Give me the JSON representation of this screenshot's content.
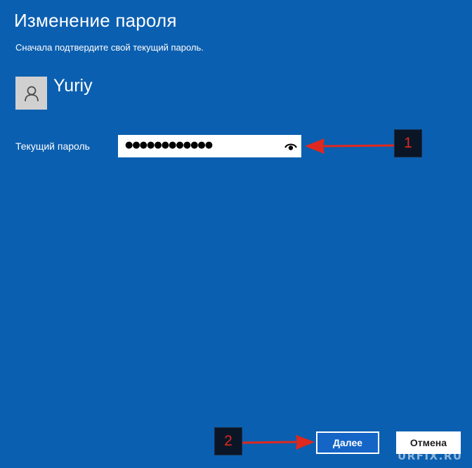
{
  "dialog": {
    "title": "Изменение пароля",
    "subtitle": "Сначала подтвердите свой текущий пароль."
  },
  "account": {
    "username": "Yuriy",
    "avatar_icon": "user-silhouette-icon"
  },
  "current_password": {
    "label": "Текущий пароль",
    "masked_value": "●●●●●●●●●●●●",
    "reveal_icon": "eye-icon"
  },
  "callouts": {
    "first": "1",
    "second": "2",
    "color": "#e0281e"
  },
  "buttons": {
    "next_label": "Далее",
    "cancel_label": "Отмена"
  },
  "watermark": "URFIX.RU",
  "colors": {
    "background": "#0b5fb0",
    "primary_button": "#1565c7",
    "arrow": "#e0281e"
  }
}
